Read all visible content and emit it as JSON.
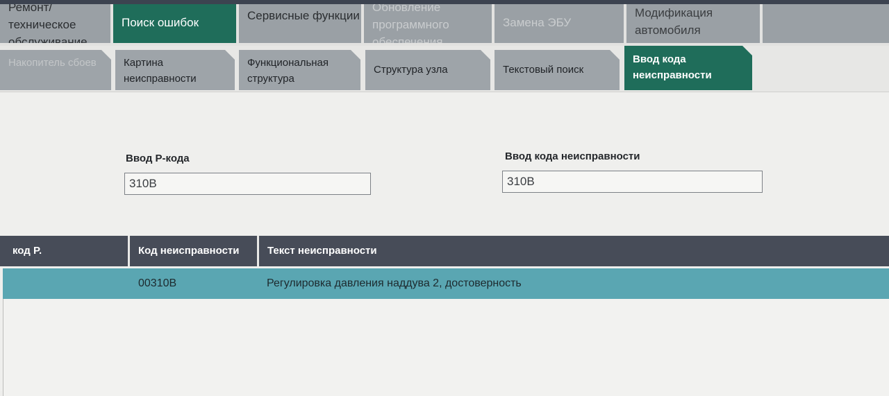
{
  "main_tabs": [
    {
      "label": "Ремонт/ техническое обслуживание"
    },
    {
      "label": "Поиск ошибок"
    },
    {
      "label": "Сервисные функции"
    },
    {
      "label": "Обновление программного обеспечения"
    },
    {
      "label": "Замена ЭБУ"
    },
    {
      "label": "Модификация автомобиля"
    }
  ],
  "sub_tabs": [
    {
      "label": "Накопитель сбоев"
    },
    {
      "label": "Картина неисправности"
    },
    {
      "label": "Функциональная структура"
    },
    {
      "label": "Структура узла"
    },
    {
      "label": "Текстовый поиск"
    },
    {
      "label": "Ввод кода неисправности"
    }
  ],
  "form": {
    "p_code_label": "Ввод P-кода",
    "p_code_value": "310B",
    "fault_code_label": "Ввод кода неисправности",
    "fault_code_value": "310B"
  },
  "table": {
    "headers": [
      "код P.",
      "Код неисправности",
      "Текст неисправности"
    ],
    "rows": [
      {
        "p_code": "",
        "fault_code": "00310B",
        "text": "Регулировка давления наддува 2, достоверность"
      }
    ]
  },
  "colors": {
    "active_tab": "#1f6d5a",
    "inactive_tab": "#9aa0a5",
    "table_header": "#474c58",
    "selected_row": "#5aa6b2"
  }
}
